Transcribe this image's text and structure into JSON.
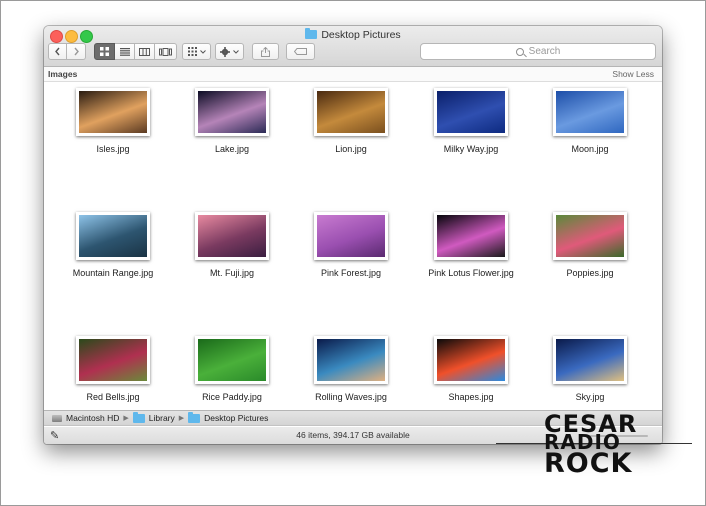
{
  "window": {
    "title": "Desktop Pictures"
  },
  "toolbar": {
    "back_icon": "chevron-left-icon",
    "forward_icon": "chevron-right-icon",
    "view_modes": [
      "icon-view",
      "list-view",
      "column-view",
      "cover-flow-view"
    ],
    "active_view": "icon-view",
    "search_placeholder": "Search"
  },
  "section": {
    "title": "Images",
    "toggle_label": "Show Less"
  },
  "items": [
    {
      "name": "Isles.jpg",
      "colors": [
        "#2a1c12",
        "#e0a15f",
        "#5a3a22"
      ]
    },
    {
      "name": "Lake.jpg",
      "colors": [
        "#0c0c24",
        "#b584b8",
        "#2a2a55"
      ]
    },
    {
      "name": "Lion.jpg",
      "colors": [
        "#4a2a10",
        "#c48a3c",
        "#7a4f1e"
      ]
    },
    {
      "name": "Milky Way.jpg",
      "colors": [
        "#0a1f6a",
        "#2f4fb0",
        "#0d2a80"
      ]
    },
    {
      "name": "Moon.jpg",
      "colors": [
        "#1d4ea8",
        "#6a9ae0",
        "#2f67c0"
      ]
    },
    {
      "name": "Mountain Range.jpg",
      "colors": [
        "#8ec3e8",
        "#2d5570",
        "#1a3344"
      ]
    },
    {
      "name": "Mt. Fuji.jpg",
      "colors": [
        "#e88aa0",
        "#7a3a60",
        "#3a1e40"
      ]
    },
    {
      "name": "Pink Forest.jpg",
      "colors": [
        "#c87bd0",
        "#9a4fb0",
        "#5a2a70"
      ]
    },
    {
      "name": "Pink Lotus Flower.jpg",
      "colors": [
        "#05050a",
        "#d05ac0",
        "#1a1a1a"
      ]
    },
    {
      "name": "Poppies.jpg",
      "colors": [
        "#5a8a3a",
        "#e05a7a",
        "#3a6a2a"
      ]
    },
    {
      "name": "Red Bells.jpg",
      "colors": [
        "#2a4a1a",
        "#b03050",
        "#6a8a3a"
      ]
    },
    {
      "name": "Rice Paddy.jpg",
      "colors": [
        "#1a6a1a",
        "#4ab03a",
        "#2a8a2a"
      ]
    },
    {
      "name": "Rolling Waves.jpg",
      "colors": [
        "#0a1a4a",
        "#3a8ac0",
        "#e0b080"
      ]
    },
    {
      "name": "Shapes.jpg",
      "colors": [
        "#0a0a0a",
        "#f0502a",
        "#2a8ae0"
      ]
    },
    {
      "name": "Sky.jpg",
      "colors": [
        "#0a1a4a",
        "#3a6ac0",
        "#e0c080"
      ]
    }
  ],
  "pathbar": {
    "segments": [
      "Macintosh HD",
      "Library",
      "Desktop Pictures"
    ]
  },
  "status": {
    "text": "46 items, 394.17 GB available"
  },
  "watermark": {
    "line1": "CESAR",
    "line2": "RADIO",
    "line3": "ROCK"
  }
}
